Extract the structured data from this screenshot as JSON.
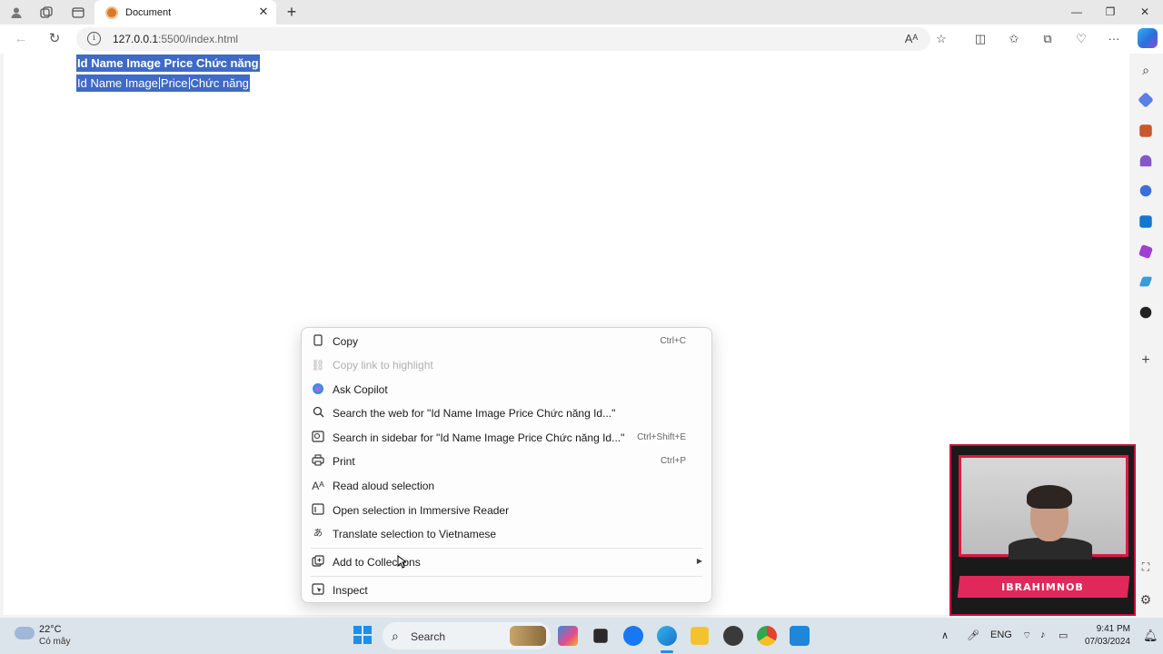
{
  "browser": {
    "tab_title": "Document",
    "url_host": "127.0.0.1",
    "url_rest": ":5500/index.html"
  },
  "page": {
    "header_row": [
      "Id",
      "Name",
      "Image",
      "Price",
      "Chức năng"
    ],
    "data_row": [
      "Id",
      "Name",
      "Image",
      "Price",
      "Chức năng"
    ]
  },
  "context_menu": {
    "items": [
      {
        "label": "Copy",
        "shortcut": "Ctrl+C",
        "icon": "copy-icon"
      },
      {
        "label": "Copy link to highlight",
        "shortcut": "",
        "icon": "link-icon",
        "disabled": true
      },
      {
        "label": "Ask Copilot",
        "shortcut": "",
        "icon": "copilot-icon"
      },
      {
        "label": "Search the web for \"Id Name Image Price Chức năng Id...\"",
        "shortcut": "",
        "icon": "search-icon"
      },
      {
        "label": "Search in sidebar for \"Id Name Image Price Chức năng Id...\"",
        "shortcut": "Ctrl+Shift+E",
        "icon": "sidebar-search-icon"
      },
      {
        "label": "Print",
        "shortcut": "Ctrl+P",
        "icon": "print-icon"
      },
      {
        "label": "Read aloud selection",
        "shortcut": "",
        "icon": "read-aloud-icon"
      },
      {
        "label": "Open selection in Immersive Reader",
        "shortcut": "",
        "icon": "immersive-reader-icon"
      },
      {
        "label": "Translate selection to Vietnamese",
        "shortcut": "",
        "icon": "translate-icon"
      },
      {
        "label": "Add to Collections",
        "shortcut": "",
        "icon": "collections-icon"
      },
      {
        "label": "Inspect",
        "shortcut": "",
        "icon": "inspect-icon"
      }
    ]
  },
  "overlay": {
    "streamer_name": "IBRAHIMNOB"
  },
  "taskbar": {
    "weather_temp": "22°C",
    "weather_desc": "Có mây",
    "search_label": "Search",
    "lang": "ENG",
    "time": "9:41 PM",
    "date": "07/03/2024"
  },
  "colors": {
    "selection": "#3f6ac6",
    "accent": "#1e8fe8"
  }
}
